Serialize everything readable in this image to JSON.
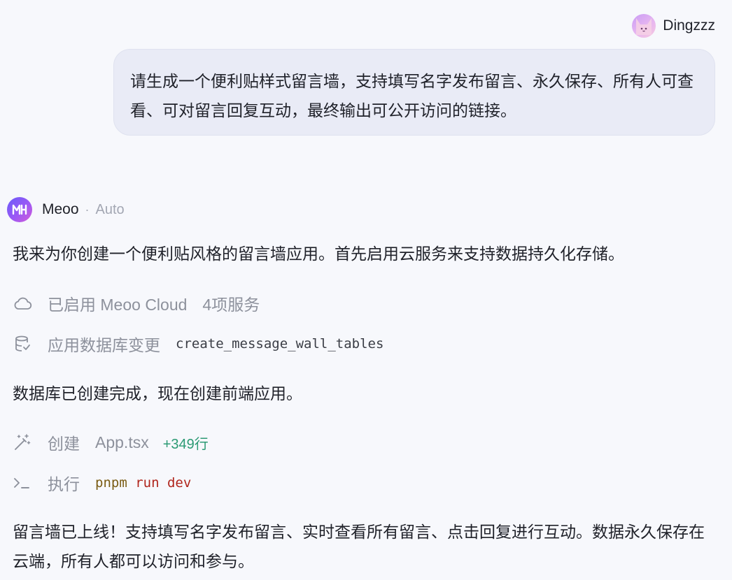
{
  "user": {
    "name": "Dingzzz",
    "message": "请生成一个便利贴样式留言墙，支持填写名字发布留言、永久保存、所有人可查看、可对留言回复互动，最终输出可公开访问的链接。"
  },
  "assistant": {
    "name": "Meoo",
    "separator": "·",
    "mode": "Auto",
    "intro": "我来为你创建一个便利贴风格的留言墙应用。首先启用云服务来支持数据持久化存储。",
    "steps": [
      {
        "icon": "cloud-icon",
        "label": "已启用 Meoo Cloud",
        "detail": "4项服务"
      },
      {
        "icon": "database-icon",
        "label": "应用数据库变更",
        "detail": "create_message_wall_tables"
      }
    ],
    "middle": "数据库已创建完成，现在创建前端应用。",
    "steps2": [
      {
        "icon": "magic-wand-icon",
        "label": "创建",
        "detail": "App.tsx",
        "added": "+349行"
      },
      {
        "icon": "terminal-icon",
        "label": "执行",
        "cmd_part1": "pnpm",
        "cmd_part2": "run dev"
      }
    ],
    "outro": "留言墙已上线！支持填写名字发布留言、实时查看所有留言、点击回复进行互动。数据永久保存在云端，所有人都可以访问和参与。"
  },
  "colors": {
    "background": "#f7f8fc",
    "bubble": "#e9ebf6",
    "muted": "#8d919c",
    "added_green": "#2c9a74",
    "cmd_brown": "#7a5c14",
    "cmd_red": "#b0251c"
  }
}
